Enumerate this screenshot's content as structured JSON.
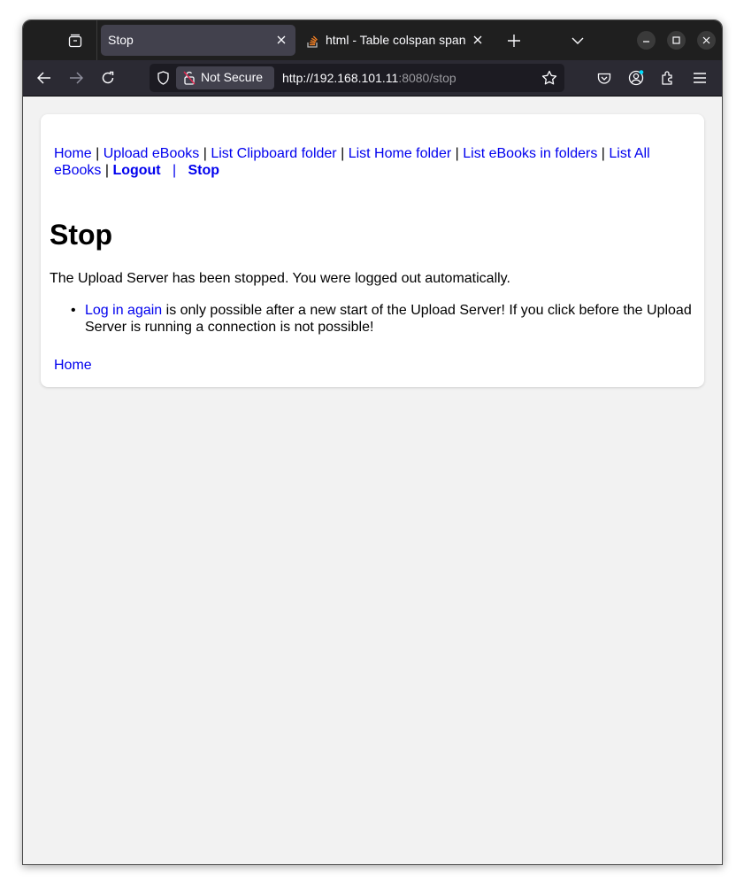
{
  "browser": {
    "tabs": [
      {
        "title": "Stop",
        "active": true
      },
      {
        "title": "html - Table colspan span",
        "active": false
      }
    ],
    "security_label": "Not Secure",
    "url_host": "http://192.168.101.11",
    "url_rest": ":8080/stop"
  },
  "nav": {
    "home": "Home",
    "upload": "Upload eBooks",
    "clipboard": "List Clipboard folder",
    "home_folder": "List Home folder",
    "ebooks_folders": "List eBooks in folders",
    "all_ebooks": "List All eBooks",
    "logout": "Logout",
    "stop": "Stop",
    "sep": "|"
  },
  "page": {
    "heading": "Stop",
    "message": "The Upload Server has been stopped. You were logged out automatically.",
    "login_link": "Log in again",
    "login_note": " is only possible after a new start of the Upload Server! If you click before the Upload Server is running a connection is not possible!",
    "home_link": "Home"
  },
  "colors": {
    "link": "#0000ee",
    "tabbar": "#1f1f1f",
    "navbar": "#2b2a33",
    "page_bg": "#f2f2f2"
  }
}
